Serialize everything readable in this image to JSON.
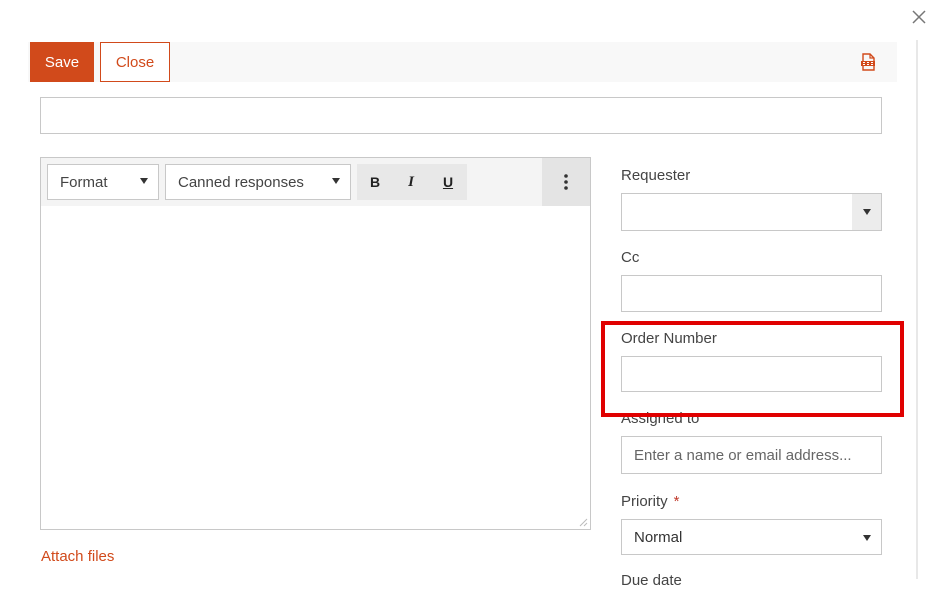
{
  "toolbar": {
    "save_label": "Save",
    "close_label": "Close",
    "pdf_icon": "pdf-icon"
  },
  "subject": {
    "value": ""
  },
  "editor": {
    "format_label": "Format",
    "canned_label": "Canned responses",
    "bold_label": "B",
    "italic_label": "I",
    "underline_label": "U",
    "body": ""
  },
  "attach_label": "Attach files",
  "fields": {
    "requester_label": "Requester",
    "requester_value": "",
    "cc_label": "Cc",
    "cc_value": "",
    "order_label": "Order Number",
    "order_value": "",
    "assigned_label": "Assigned to",
    "assigned_placeholder": "Enter a name or email address...",
    "priority_label": "Priority",
    "priority_required": "*",
    "priority_value": "Normal",
    "duedate_label": "Due date"
  },
  "colors": {
    "accent": "#d14a1b",
    "highlight": "#e00000"
  }
}
